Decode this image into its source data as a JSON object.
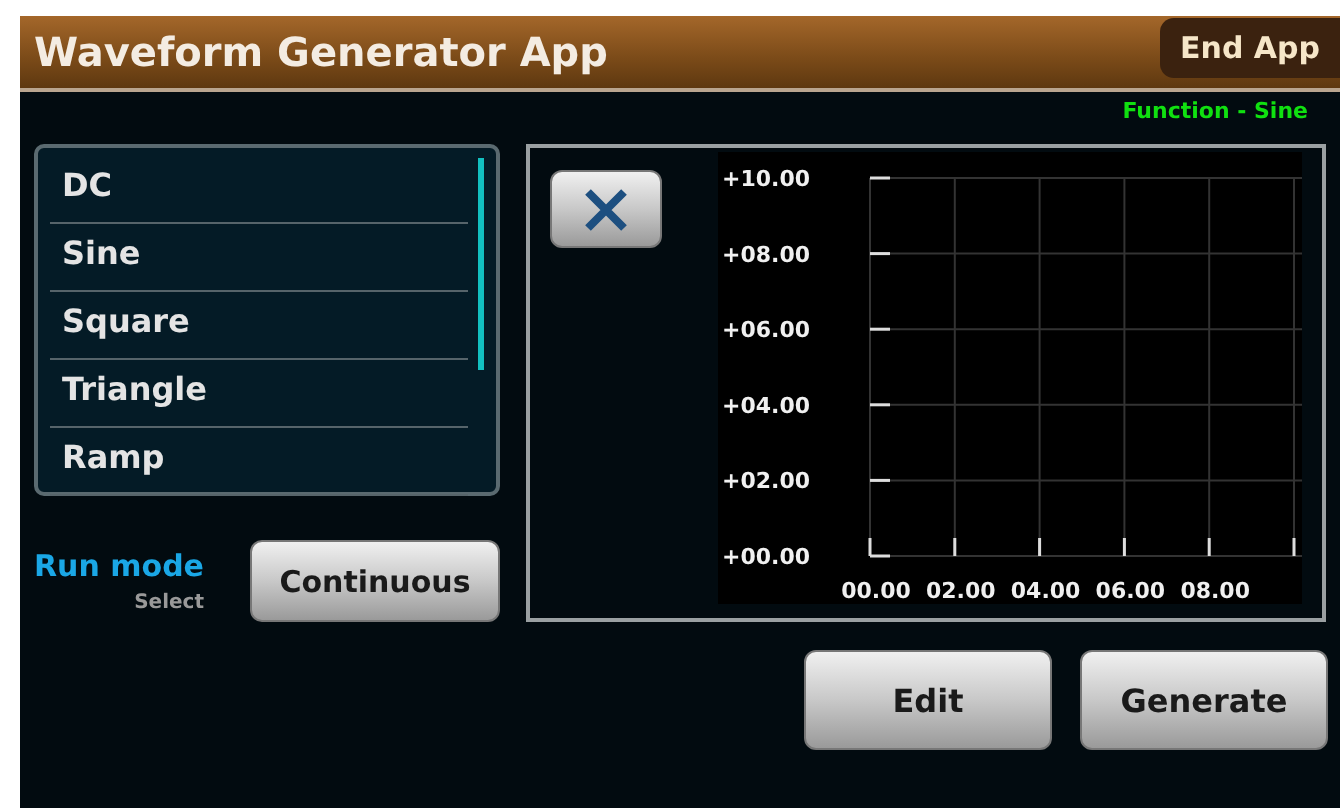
{
  "window": {
    "title": "Waveform Generator App",
    "end_button": "End App"
  },
  "status": "Function - Sine",
  "functions": [
    {
      "label": "DC"
    },
    {
      "label": "Sine"
    },
    {
      "label": "Square"
    },
    {
      "label": "Triangle"
    },
    {
      "label": "Ramp"
    }
  ],
  "run_mode": {
    "label": "Run mode",
    "hint": "Select",
    "value": "Continuous"
  },
  "chart_data": {
    "type": "line",
    "grid": true,
    "xlim": [
      0,
      10
    ],
    "ylim": [
      0,
      10
    ],
    "xticks": [
      {
        "value": 0,
        "label": "00.00"
      },
      {
        "value": 2,
        "label": "02.00"
      },
      {
        "value": 4,
        "label": "04.00"
      },
      {
        "value": 6,
        "label": "06.00"
      },
      {
        "value": 8,
        "label": "08.00"
      }
    ],
    "yticks": [
      {
        "value": 0,
        "label": "+00.00"
      },
      {
        "value": 2,
        "label": "+02.00"
      },
      {
        "value": 4,
        "label": "+04.00"
      },
      {
        "value": 6,
        "label": "+06.00"
      },
      {
        "value": 8,
        "label": "+08.00"
      },
      {
        "value": 10,
        "label": "+10.00"
      }
    ]
  },
  "buttons": [
    "Edit",
    "Generate"
  ]
}
